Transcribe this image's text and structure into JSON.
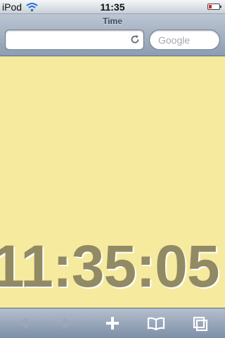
{
  "status_bar": {
    "carrier": "iPod",
    "time": "11:35",
    "battery_color": "#d22222"
  },
  "navigation": {
    "title": "Time",
    "url_value": "",
    "search_placeholder": "Google"
  },
  "content": {
    "background": "#f6ea9f",
    "clock_text": "11:35:05",
    "clock_color": "#918a63"
  },
  "toolbar": {
    "icons": [
      "back-arrow-icon",
      "forward-arrow-icon",
      "add-plus-icon",
      "bookmarks-book-icon",
      "pages-icon"
    ]
  }
}
